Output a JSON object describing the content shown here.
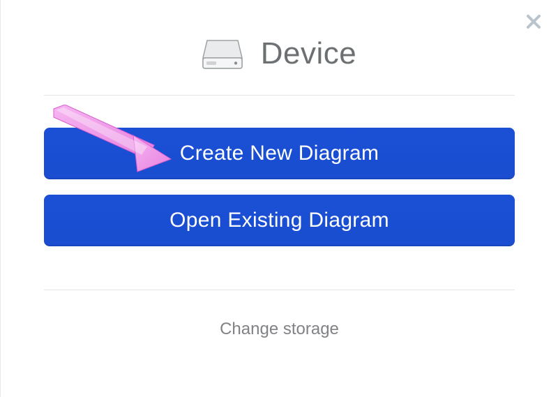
{
  "header": {
    "title": "Device",
    "icon_name": "drive-icon"
  },
  "buttons": {
    "create_label": "Create New Diagram",
    "open_label": "Open Existing Diagram"
  },
  "footer": {
    "change_storage_label": "Change storage"
  },
  "close": {
    "icon_name": "close-icon"
  },
  "colors": {
    "primary_button": "#1b4fd1",
    "annotation_arrow": "#e77fe0"
  }
}
